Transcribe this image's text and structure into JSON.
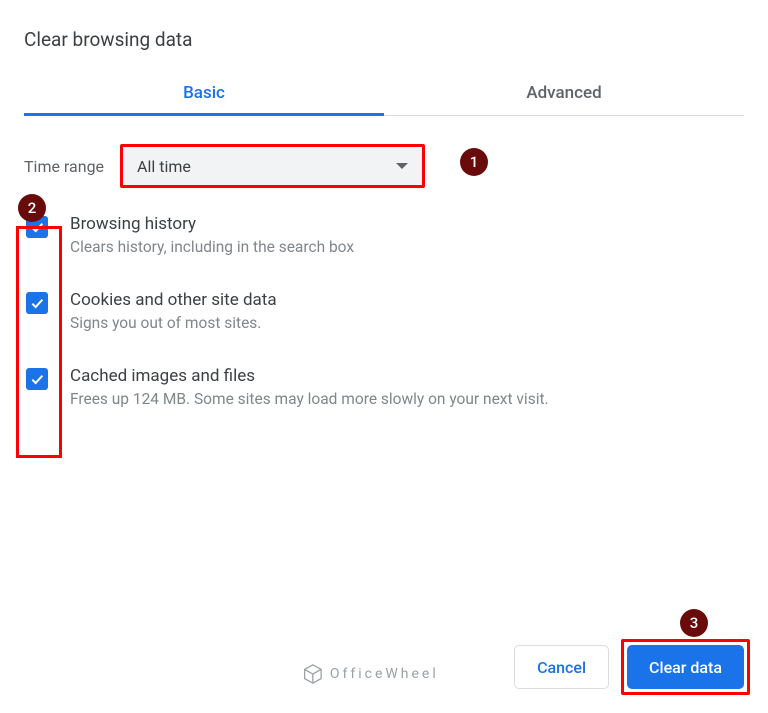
{
  "title": "Clear browsing data",
  "tabs": {
    "basic": "Basic",
    "advanced": "Advanced"
  },
  "timerange": {
    "label": "Time range",
    "value": "All time"
  },
  "options": [
    {
      "title": "Browsing history",
      "desc": "Clears history, including in the search box"
    },
    {
      "title": "Cookies and other site data",
      "desc": "Signs you out of most sites."
    },
    {
      "title": "Cached images and files",
      "desc": "Frees up 124 MB. Some sites may load more slowly on your next visit."
    }
  ],
  "buttons": {
    "cancel": "Cancel",
    "clear": "Clear data"
  },
  "annotations": {
    "a1": "1",
    "a2": "2",
    "a3": "3"
  },
  "watermark": "OfficeWheel"
}
